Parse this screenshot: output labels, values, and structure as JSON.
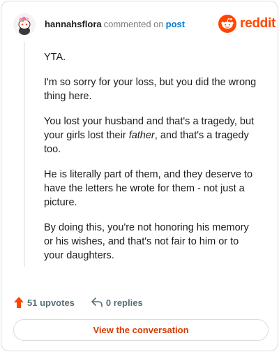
{
  "header": {
    "username": "hannahsflora",
    "commented_text": "commented on",
    "post_link": "post",
    "brand": "reddit",
    "brand_color": "#ff4500",
    "avatar_icon": "snoo-avatar-icon"
  },
  "comment": {
    "paragraphs": [
      {
        "text": "YTA."
      },
      {
        "text": "I'm so sorry for your loss, but you did the wrong thing here."
      },
      {
        "before": "You lost your husband and that's a tragedy, but your girls lost their ",
        "italic": "father",
        "after": ", and that's a tragedy too."
      },
      {
        "text": "He is literally part of them, and they deserve to have the letters he wrote for them - not just a picture."
      },
      {
        "text": "By doing this, you're not honoring his memory or his wishes, and that's not fair to him or to your daughters."
      }
    ]
  },
  "footer": {
    "upvotes": "51 upvotes",
    "replies": "0 replies",
    "view_button": "View the conversation",
    "upvote_color": "#ff4500",
    "view_color": "#d93a00"
  }
}
